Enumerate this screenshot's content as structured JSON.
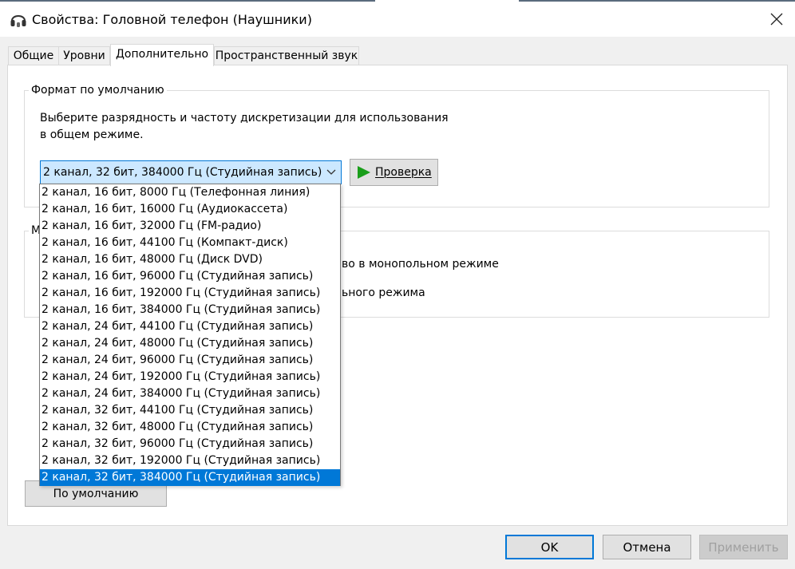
{
  "window": {
    "title": "Свойства: Головной телефон (Наушники)",
    "close_glyph": "✕"
  },
  "tabs": [
    {
      "label": "Общие"
    },
    {
      "label": "Уровни"
    },
    {
      "label": "Дополнительно"
    },
    {
      "label": "Пространственный звук"
    }
  ],
  "active_tab": "Дополнительно",
  "default_format": {
    "legend": "Формат по умолчанию",
    "description_line1": "Выберите разрядность и частоту дискретизации для использования",
    "description_line2": "в общем режиме.",
    "selected": "2 канал, 32 бит, 384000 Гц (Студийная запись)",
    "test_button": "Проверка",
    "options": [
      "2 канал, 16 бит, 8000 Гц (Телефонная линия)",
      "2 канал, 16 бит, 16000 Гц (Аудиокассета)",
      "2 канал, 16 бит, 32000 Гц (FM-радио)",
      "2 канал, 16 бит, 44100 Гц (Компакт-диск)",
      "2 канал, 16 бит, 48000 Гц (Диск DVD)",
      "2 канал, 16 бит, 96000 Гц (Студийная запись)",
      "2 канал, 16 бит, 192000 Гц (Студийная запись)",
      "2 канал, 16 бит, 384000 Гц (Студийная запись)",
      "2 канал, 24 бит, 44100 Гц (Студийная запись)",
      "2 канал, 24 бит, 48000 Гц (Студийная запись)",
      "2 канал, 24 бит, 96000 Гц (Студийная запись)",
      "2 канал, 24 бит, 192000 Гц (Студийная запись)",
      "2 канал, 24 бит, 384000 Гц (Студийная запись)",
      "2 канал, 32 бит, 44100 Гц (Студийная запись)",
      "2 канал, 32 бит, 48000 Гц (Студийная запись)",
      "2 канал, 32 бит, 96000 Гц (Студийная запись)",
      "2 канал, 32 бит, 192000 Гц (Студийная запись)",
      "2 канал, 32 бит, 384000 Гц (Студийная запись)"
    ],
    "selected_index": 17
  },
  "exclusive_mode": {
    "legend_visible": "М",
    "line1_visible": "во в монопольном режиме",
    "line2_visible": "ьного режима"
  },
  "restore_defaults_button": "По умолчанию",
  "buttons": {
    "ok": "OK",
    "cancel": "Отмена",
    "apply": "Применить"
  },
  "colors": {
    "accent": "#0078d7",
    "selection_bg": "#cce8ff",
    "play_icon": "#1a9e1a"
  }
}
